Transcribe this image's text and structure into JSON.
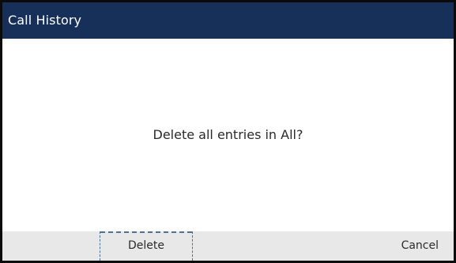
{
  "header": {
    "title": "Call History"
  },
  "dialog": {
    "message": "Delete all entries in All?"
  },
  "softkeys": {
    "delete_label": "Delete",
    "cancel_label": "Cancel"
  },
  "colors": {
    "title_bar": "#17305a",
    "softkey_bar": "#e8e8e8",
    "focus_outline": "#4d6f9a"
  }
}
